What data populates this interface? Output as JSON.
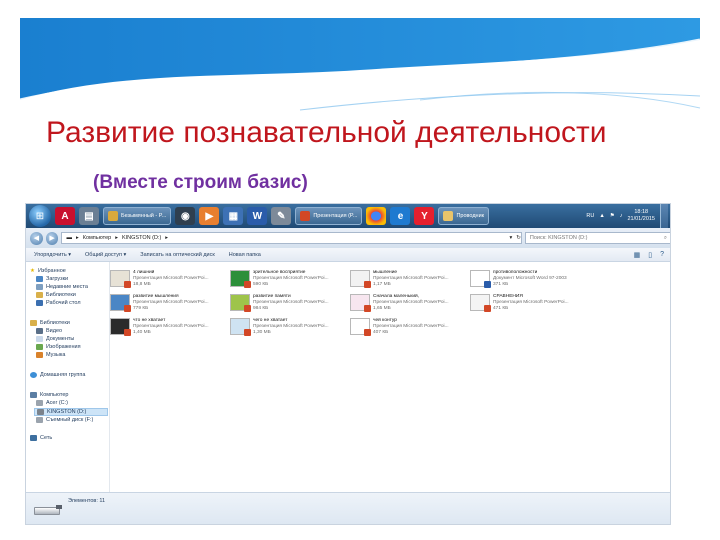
{
  "slide": {
    "title": "Развитие познавательной деятельности",
    "subtitle": "(Вместе строим базис)",
    "colors": {
      "title": "#c0161d",
      "subtitle": "#7030a0",
      "wave": "#2d8fd6"
    }
  },
  "taskbar": {
    "windows": [
      {
        "icon": "paint-icon",
        "label": "Безымянный - P...",
        "color": "#d9a93d"
      },
      {
        "icon": "powerpoint-icon",
        "label": "Презентация (P...",
        "color": "#d24726"
      },
      {
        "icon": "folder-icon",
        "label": "Проводник",
        "color": "#e9c46a"
      }
    ],
    "tray": {
      "language": "RU",
      "time": "18:18",
      "date": "21/01/2015"
    }
  },
  "explorer": {
    "path": [
      "Компьютер",
      "KINGSTON (D:)"
    ],
    "search_placeholder": "Поиск: KINGSTON (D:)",
    "toolbar": [
      "Упорядочить ▾",
      "Общий доступ ▾",
      "Записать на оптический диск",
      "Новая папка"
    ],
    "nav": {
      "favorites": [
        "Избранное",
        "Загрузки",
        "Недавние места",
        "Библиотеки",
        "Рабочий стол"
      ],
      "libraries": [
        "Библиотеки",
        "Видео",
        "Документы",
        "Изображения",
        "Музыка"
      ],
      "homegroup": "Домашняя группа",
      "computer": [
        "Компьютер",
        "Acer (C:)",
        "KINGSTON (D:)",
        "Съемный диск (F:)"
      ],
      "network": "Сеть"
    },
    "files": [
      {
        "name": "4 лишний",
        "type": "Презентация Microsoft PowerPoi...",
        "size": "18,8 МБ",
        "thumb": "#e7e2d6"
      },
      {
        "name": "зрительное восприятие",
        "type": "Презентация Microsoft PowerPoi...",
        "size": "590 КБ",
        "thumb": "#2c8f3a"
      },
      {
        "name": "мышление",
        "type": "Презентация Microsoft PowerPoi...",
        "size": "1,17 МБ",
        "thumb": "#f2f2f2"
      },
      {
        "name": "противоположности",
        "type": "Документ Microsoft Word 97-2003",
        "size": "371 КБ",
        "thumb": "#ffffff",
        "word": true
      },
      {
        "name": "развитие мышления",
        "type": "Презентация Microsoft PowerPoi...",
        "size": "779 КБ",
        "thumb": "#4a86c5"
      },
      {
        "name": "развитие памяти",
        "type": "Презентация Microsoft PowerPoi...",
        "size": "984 КБ",
        "thumb": "#9ec44a"
      },
      {
        "name": "Сначала маленький,",
        "type": "Презентация Microsoft PowerPoi...",
        "size": "1,65 МБ",
        "thumb": "#f7e6ef"
      },
      {
        "name": "СРАВНЕНИЯ",
        "type": "Презентация Microsoft PowerPoi...",
        "size": "471 КБ",
        "thumb": "#f4f4f4"
      },
      {
        "name": "что не хватает",
        "type": "Презентация Microsoft PowerPoi...",
        "size": "1,40 МБ",
        "thumb": "#2b2b2b"
      },
      {
        "name": "чего не хватает",
        "type": "Презентация Microsoft PowerPoi...",
        "size": "1,30 МБ",
        "thumb": "#cfe3f2"
      },
      {
        "name": "чей контур",
        "type": "Презентация Microsoft PowerPoi...",
        "size": "407 КБ",
        "thumb": "#ffffff"
      }
    ],
    "status": "Элементов: 11"
  }
}
